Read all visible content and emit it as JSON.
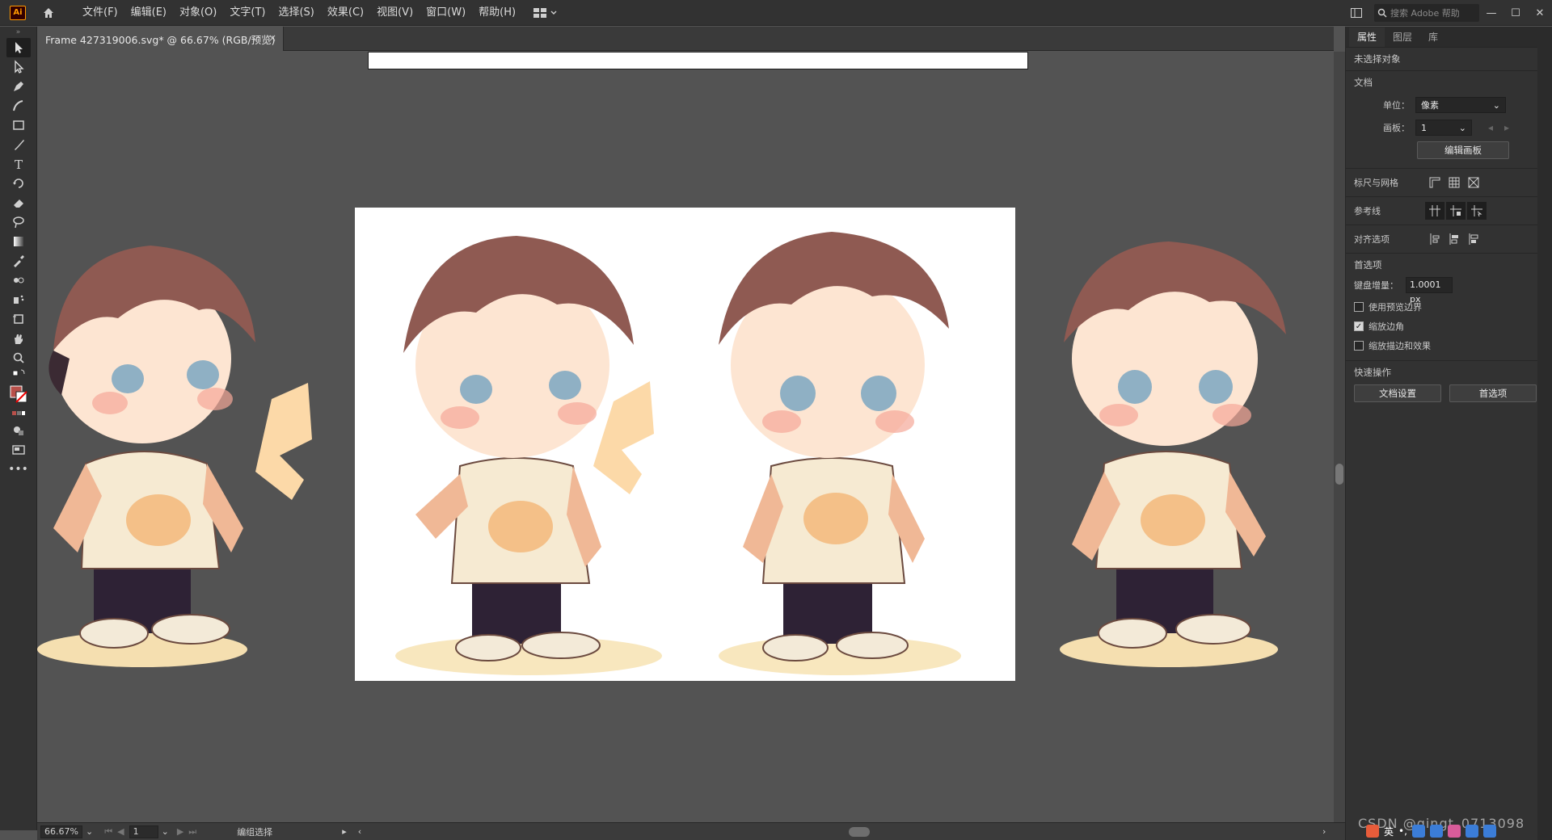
{
  "app": {
    "logo": "Ai"
  },
  "menu": [
    "文件(F)",
    "编辑(E)",
    "对象(O)",
    "文字(T)",
    "选择(S)",
    "效果(C)",
    "视图(V)",
    "窗口(W)",
    "帮助(H)"
  ],
  "search": {
    "placeholder": "搜索 Adobe 帮助"
  },
  "tab": {
    "title": "Frame 427319006.svg* @ 66.67% (RGB/预览)",
    "close": "×"
  },
  "status": {
    "zoom": "66.67%",
    "artboard": "1",
    "selection": "编组选择"
  },
  "panel": {
    "tabs": [
      "属性",
      "图层",
      "库"
    ],
    "no_selection": "未选择对象",
    "document": {
      "heading": "文档",
      "unit_label": "单位：",
      "unit_value": "像素",
      "artboard_label": "画板：",
      "artboard_value": "1",
      "edit_artboards": "编辑画板"
    },
    "rulers_grids": "标尺与网格",
    "guides": "参考线",
    "align": "对齐选项",
    "preferences": {
      "heading": "首选项",
      "keyboard_increment_label": "键盘增量：",
      "keyboard_increment_value": "1.0001 px",
      "use_preview_bounds": "使用预览边界",
      "scale_corners": "缩放边角",
      "scale_strokes": "缩放描边和效果",
      "use_preview_bounds_checked": false,
      "scale_corners_checked": true,
      "scale_strokes_checked": false
    },
    "quick_actions": {
      "heading": "快速操作",
      "doc_setup": "文档设置",
      "prefs": "首选项"
    }
  },
  "tray": {
    "ime": "英"
  },
  "watermark": "CSDN @qingt_0713098",
  "colors": {
    "ui_dark": "#323232",
    "canvas": "#535353",
    "artboard": "#ffffff",
    "accent": "#ff9a00"
  }
}
